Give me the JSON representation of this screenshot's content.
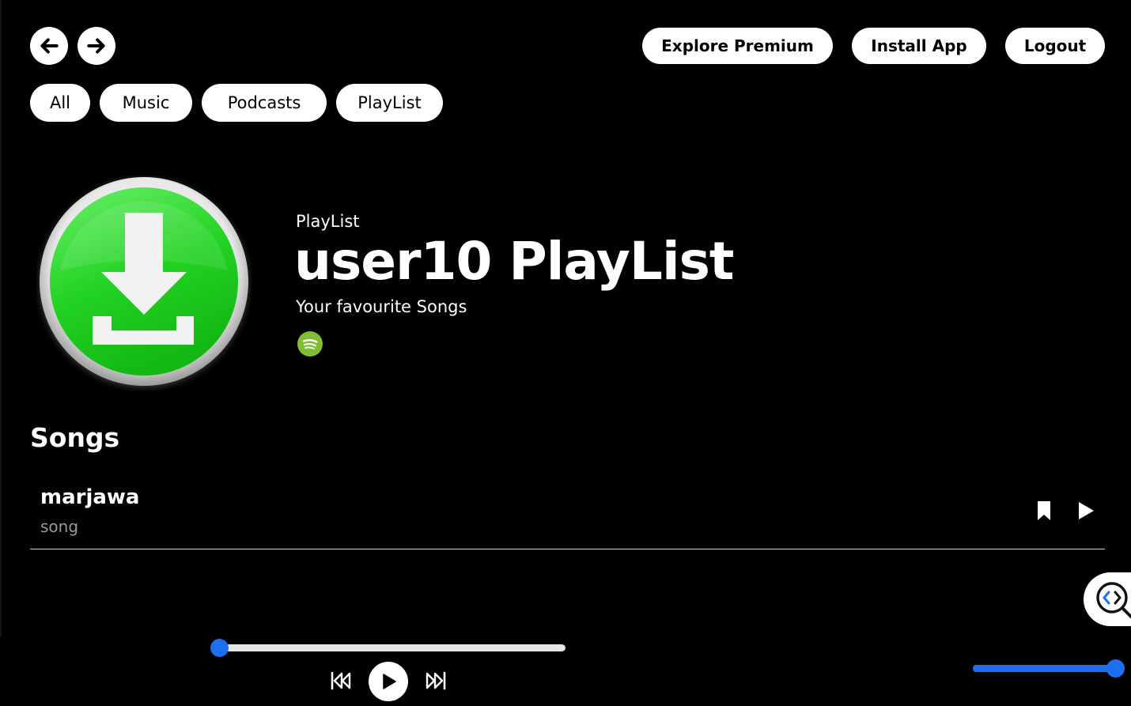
{
  "header": {
    "back_icon": "arrow-left-icon",
    "forward_icon": "arrow-right-icon",
    "explore_premium_label": "Explore Premium",
    "install_app_label": "Install App",
    "logout_label": "Logout"
  },
  "filters": [
    "All",
    "Music",
    "Podcasts",
    "PlayList"
  ],
  "playlist": {
    "cover_icon": "download-icon",
    "kicker": "PlayList",
    "title": "user10 PlayList",
    "description": "Your favourite Songs",
    "badge_icon": "spotify-icon",
    "accent_green": "#2fd32f"
  },
  "songs_section": {
    "title": "Songs",
    "items": [
      {
        "title": "marjawa",
        "type": "song",
        "bookmark_icon": "bookmark-icon",
        "play_icon": "play-icon"
      }
    ]
  },
  "corner_tool": {
    "icon": "code-search-icon"
  },
  "player": {
    "progress_fraction": 0.0,
    "volume_fraction": 1.0,
    "accent_color": "#1e6ff0",
    "prev_icon": "skip-back-icon",
    "play_icon": "play-icon",
    "next_icon": "skip-forward-icon"
  }
}
